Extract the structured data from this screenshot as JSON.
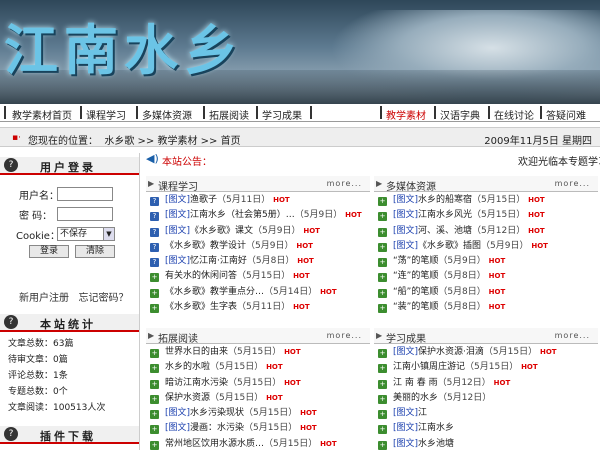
{
  "banner": {
    "logo_text": "江南水乡"
  },
  "nav": {
    "left_items": [
      "教学素材首页",
      "课程学习",
      "多媒体资源",
      "拓展阅读",
      "学习成果"
    ],
    "right_items": [
      "教学素材",
      "汉语字典",
      "在线讨论",
      "答疑问难"
    ],
    "active_color": "#cc0000"
  },
  "location": {
    "prefix": "您现在的位置：",
    "crumbs": "水乡歌 >> 教学素材 >> 首页",
    "date": "2009年11月5日  星期四"
  },
  "login": {
    "title": "用户登录",
    "username_label": "用户名：",
    "password_label": "密  码：",
    "cookie_label": "Cookie：",
    "cookie_value": "不保存",
    "login_btn": "登录",
    "clear_btn": "清除",
    "register": "新用户注册",
    "forgot": "忘记密码？"
  },
  "stats": {
    "title": "本站统计",
    "lines": [
      "文章总数：63篇",
      "待审文章：0篇",
      "评论总数：1条",
      "专题总数：0个",
      "文章阅读：100513人次"
    ]
  },
  "plugin": {
    "title": "插件下载"
  },
  "notice": {
    "label": "本站公告：",
    "text": "欢迎光临本专题学习"
  },
  "more": "more...",
  "panels": [
    {
      "title": "课程学习",
      "rows": [
        {
          "icon": "blue",
          "tag": "[图文]",
          "text": "渔歌子",
          "date": "（5月11日）",
          "hot": "HOT"
        },
        {
          "icon": "blue",
          "tag": "[图文]",
          "text": "江南水乡（社会第5册）…",
          "date": "（5月9日）",
          "hot": "HOT"
        },
        {
          "icon": "blue",
          "tag": "[图文]",
          "text": "《水乡歌》课文",
          "date": "（5月9日）",
          "hot": "HOT"
        },
        {
          "icon": "blue",
          "tag": "",
          "text": "《水乡歌》教学设计",
          "date": "（5月9日）",
          "hot": "HOT"
        },
        {
          "icon": "blue",
          "tag": "[图文]",
          "text": "忆江南·江南好",
          "date": "（5月8日）",
          "hot": "HOT"
        },
        {
          "icon": "green",
          "tag": "",
          "text": "有关水的休闲问答",
          "date": "（5月15日）",
          "hot": "HOT"
        },
        {
          "icon": "green",
          "tag": "",
          "text": "《水乡歌》教学重点分…",
          "date": "（5月14日）",
          "hot": "HOT"
        },
        {
          "icon": "green",
          "tag": "",
          "text": "《水乡歌》生字表",
          "date": "（5月11日）",
          "hot": "HOT"
        }
      ]
    },
    {
      "title": "多媒体资源",
      "rows": [
        {
          "icon": "green",
          "tag": "[图文]",
          "text": "水乡的船寒宿",
          "date": "（5月15日）",
          "hot": "HOT"
        },
        {
          "icon": "green",
          "tag": "[图文]",
          "text": "江南水乡风光",
          "date": "（5月15日）",
          "hot": "HOT"
        },
        {
          "icon": "green",
          "tag": "[图文]",
          "text": "河、溪、池塘",
          "date": "（5月12日）",
          "hot": "HOT"
        },
        {
          "icon": "green",
          "tag": "[图文]",
          "text": "《水乡歌》插图",
          "date": "（5月9日）",
          "hot": "HOT"
        },
        {
          "icon": "green",
          "tag": "",
          "text": "“荡”的笔顺",
          "date": "（5月9日）",
          "hot": "HOT"
        },
        {
          "icon": "green",
          "tag": "",
          "text": "“连”的笔顺",
          "date": "（5月8日）",
          "hot": "HOT"
        },
        {
          "icon": "green",
          "tag": "",
          "text": "“船”的笔顺",
          "date": "（5月8日）",
          "hot": "HOT"
        },
        {
          "icon": "green",
          "tag": "",
          "text": "“装”的笔顺",
          "date": "（5月8日）",
          "hot": "HOT"
        }
      ]
    },
    {
      "title": "拓展阅读",
      "rows": [
        {
          "icon": "green",
          "tag": "",
          "text": "世界水日的由来",
          "date": "（5月15日）",
          "hot": "HOT"
        },
        {
          "icon": "green",
          "tag": "",
          "text": "水乡的水啦",
          "date": "（5月15日）",
          "hot": "HOT"
        },
        {
          "icon": "green",
          "tag": "",
          "text": "暗访江南水污染",
          "date": "（5月15日）",
          "hot": "HOT"
        },
        {
          "icon": "green",
          "tag": "",
          "text": "保护水资源",
          "date": "（5月15日）",
          "hot": "HOT"
        },
        {
          "icon": "green",
          "tag": "[图文]",
          "text": "水乡污染现状",
          "date": "（5月15日）",
          "hot": "HOT"
        },
        {
          "icon": "green",
          "tag": "[图文]",
          "text": "漫画：水污染",
          "date": "（5月15日）",
          "hot": "HOT"
        },
        {
          "icon": "green",
          "tag": "",
          "text": "常州地区饮用水源水质…",
          "date": "（5月15日）",
          "hot": "HOT"
        }
      ]
    },
    {
      "title": "学习成果",
      "rows": [
        {
          "icon": "green",
          "tag": "[图文]",
          "text": "保护水资源·泪滴",
          "date": "（5月15日）",
          "hot": "HOT"
        },
        {
          "icon": "green",
          "tag": "",
          "text": "江南小镇周庄游记",
          "date": "（5月15日）",
          "hot": "HOT"
        },
        {
          "icon": "green",
          "tag": "",
          "text": "江 南 春 雨",
          "date": "（5月12日）",
          "hot": "HOT"
        },
        {
          "icon": "green",
          "tag": "",
          "text": "美丽的水乡",
          "date": "（5月12日）",
          "hot": ""
        },
        {
          "icon": "green",
          "tag": "[图文]",
          "text": "江",
          "date": "",
          "hot": ""
        },
        {
          "icon": "green",
          "tag": "[图文]",
          "text": "江南水乡",
          "date": "",
          "hot": ""
        },
        {
          "icon": "green",
          "tag": "[图文]",
          "text": "水乡池塘",
          "date": "",
          "hot": ""
        }
      ]
    }
  ]
}
